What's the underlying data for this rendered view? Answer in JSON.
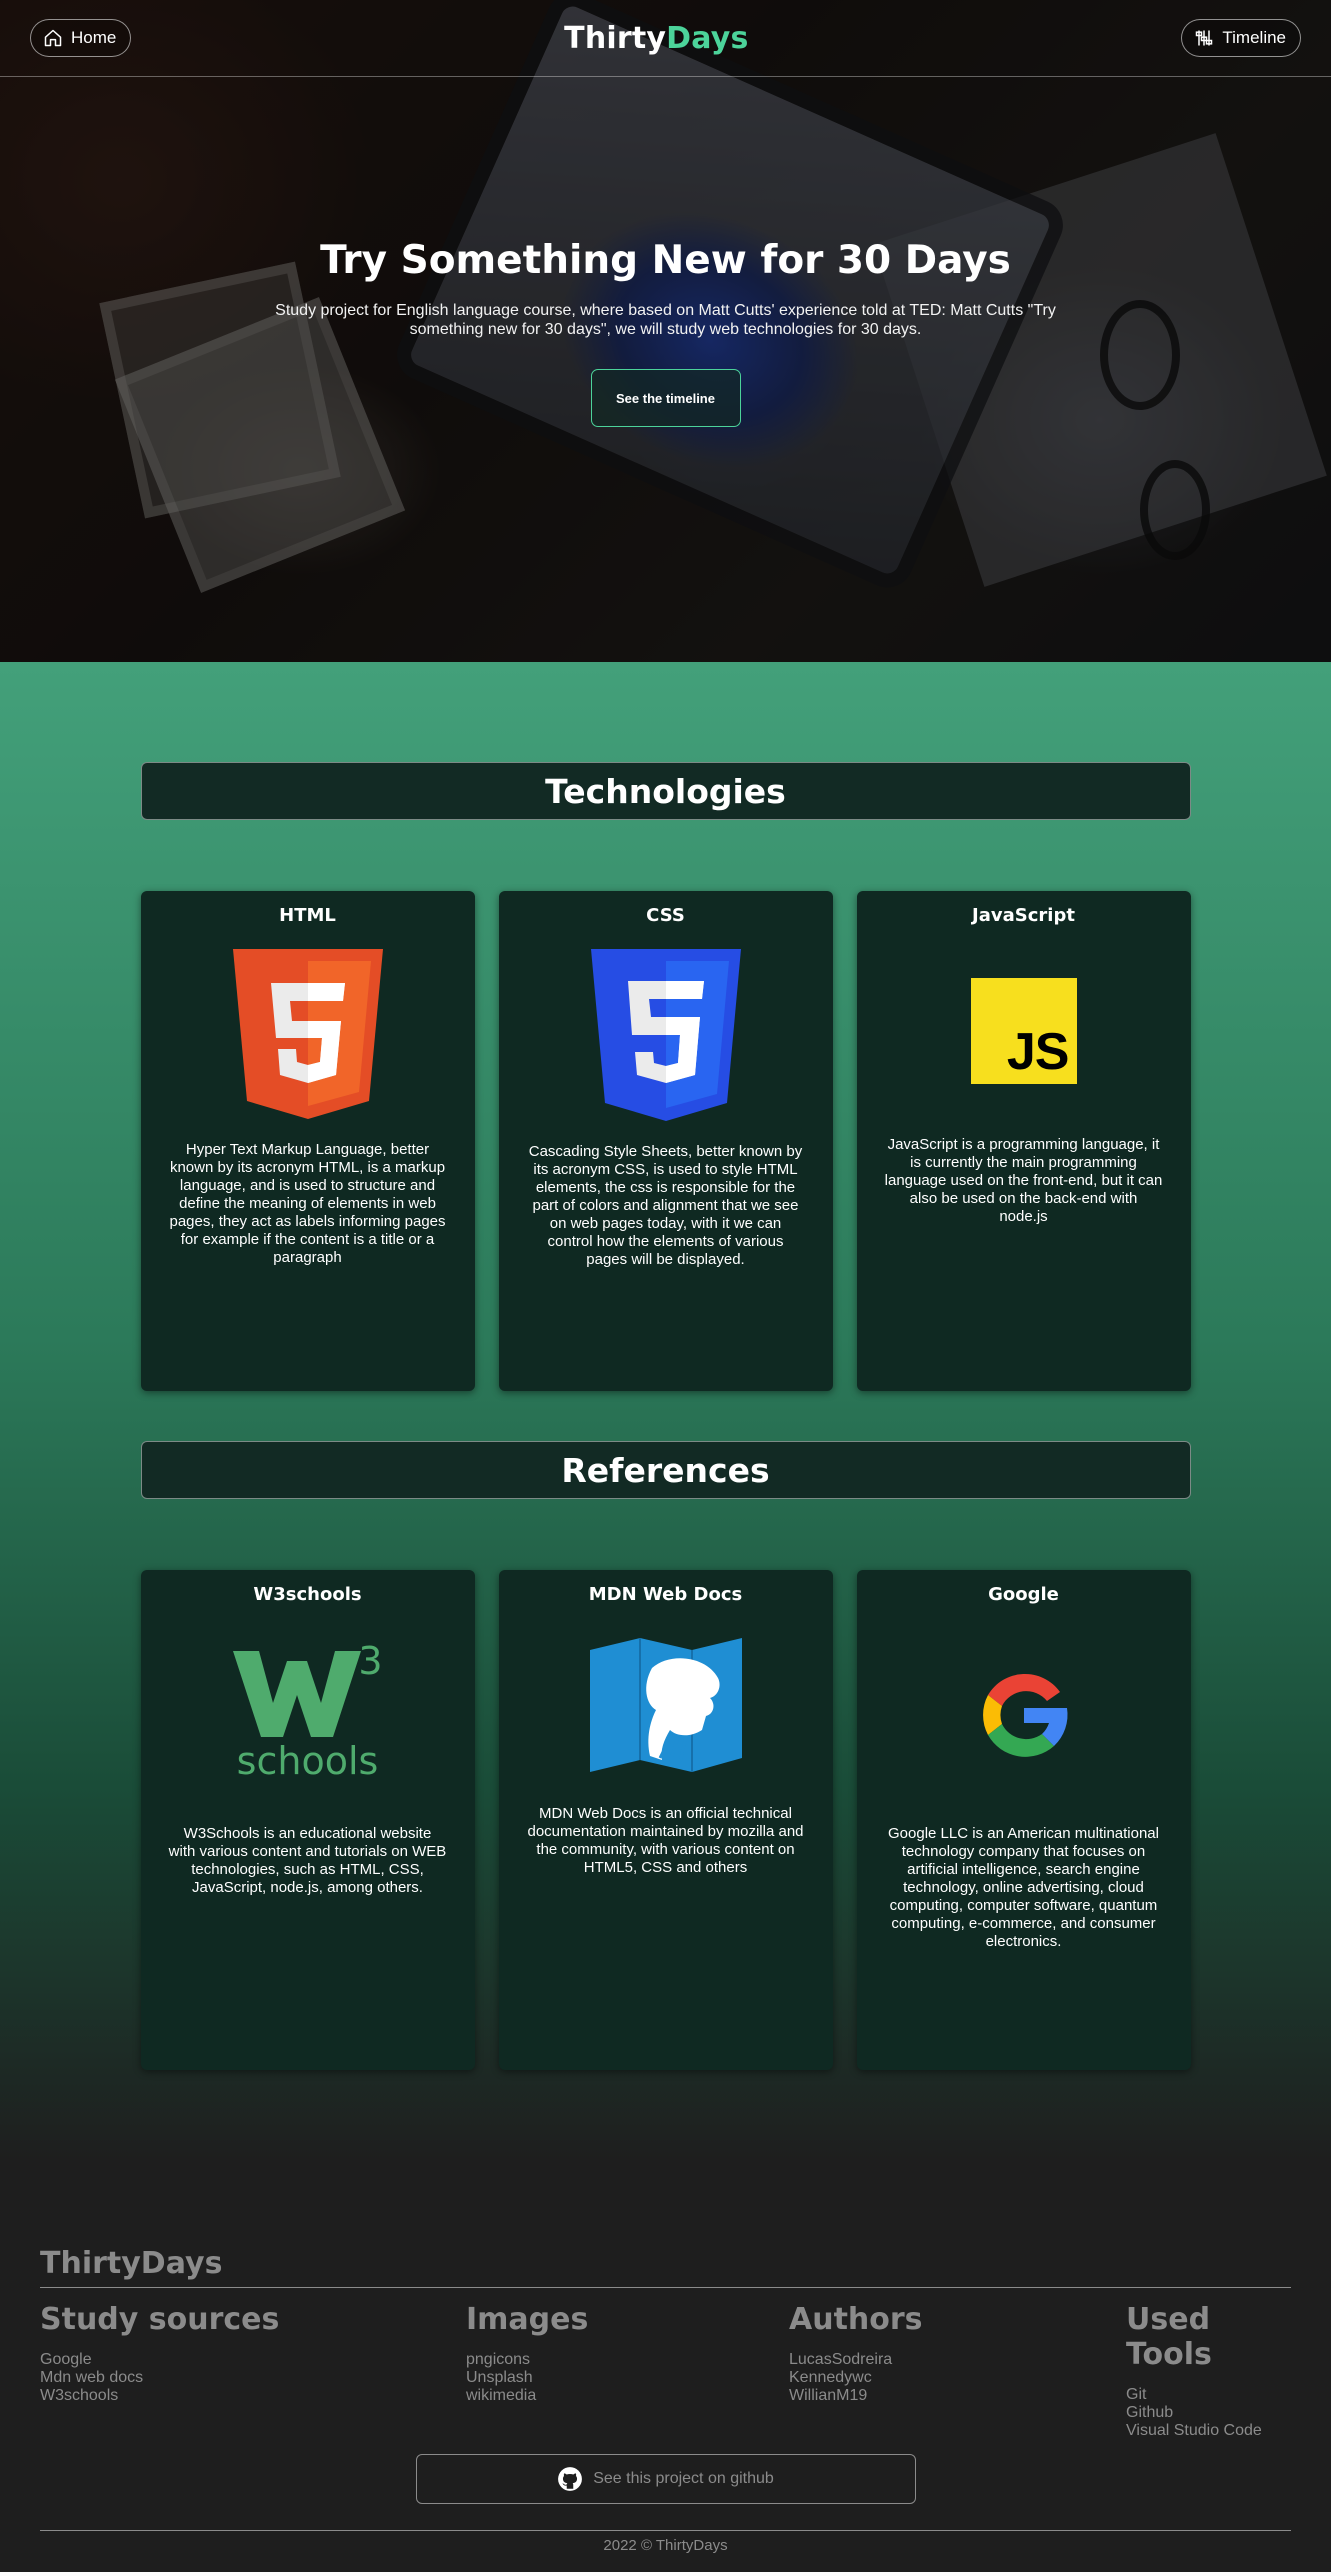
{
  "nav": {
    "home_label": "Home",
    "home_icon": "house-icon",
    "brand_part1": "Thirty",
    "brand_part2": "Days",
    "timeline_label": "Timeline",
    "timeline_icon": "timeline-icon"
  },
  "hero": {
    "title": "Try Something New for 30 Days",
    "subtitle": "Study project for English language course, where based on Matt Cutts' experience told at TED: Matt Cutts \"Try something new for 30 days\", we will study web technologies for 30 days.",
    "cta_label": "See the timeline"
  },
  "technologies": {
    "title": "Technologies",
    "cards": [
      {
        "title": "HTML",
        "icon": "html5-logo-icon",
        "text": "Hyper Text Markup Language, better known by its acronym HTML, is a markup language, and is used to structure and define the meaning of elements in web pages, they act as labels informing pages for example if the content is a title or a paragraph"
      },
      {
        "title": "CSS",
        "icon": "css3-logo-icon",
        "text": "Cascading Style Sheets, better known by its acronym CSS, is used to style HTML elements, the css is responsible for the part of colors and alignment that we see on web pages today, with it we can control how the elements of various pages will be displayed."
      },
      {
        "title": "JavaScript",
        "icon": "javascript-logo-icon",
        "logo_text": "JS",
        "text": "JavaScript is a programming language, it is currently the main programming language used on the front-end, but it can also be used on the back-end with node.js"
      }
    ]
  },
  "references": {
    "title": "References",
    "cards": [
      {
        "title": "W3schools",
        "icon": "w3schools-logo-icon",
        "logo_sup": "3",
        "logo_word": "schools",
        "text": "W3Schools is an educational website with various content and tutorials on WEB technologies, such as HTML, CSS, JavaScript, node.js, among others."
      },
      {
        "title": "MDN Web Docs",
        "icon": "mdn-logo-icon",
        "text": "MDN Web Docs is an official technical documentation maintained by mozilla and the community, with various content on HTML5, CSS and others"
      },
      {
        "title": "Google",
        "icon": "google-logo-icon",
        "text": "Google LLC is an American multinational technology company that focuses on artificial intelligence, search engine technology, online advertising, cloud computing, computer software, quantum computing, e-commerce, and consumer electronics."
      }
    ]
  },
  "footer": {
    "brand": "ThirtyDays",
    "columns": [
      {
        "title": "Study sources",
        "links": [
          "Google",
          "Mdn web docs",
          "W3schools"
        ]
      },
      {
        "title": "Images",
        "links": [
          "pngicons",
          "Unsplash",
          "wikimedia"
        ]
      },
      {
        "title": "Authors",
        "links": [
          "LucasSodreira",
          "Kennedywc",
          "WillianM19"
        ]
      },
      {
        "title": "Used Tools",
        "links": [
          "Git",
          "Github",
          "Visual Studio Code"
        ]
      }
    ],
    "github_label": "See this project on github",
    "github_icon": "github-icon",
    "copyright": "2022 © ThirtyDays"
  },
  "colors": {
    "accent": "#4cd39a",
    "card_bg": "#0f2922",
    "section_green_top": "#43a07a",
    "footer_bg": "#1e1e1e",
    "footer_text": "#8b8b8b"
  }
}
